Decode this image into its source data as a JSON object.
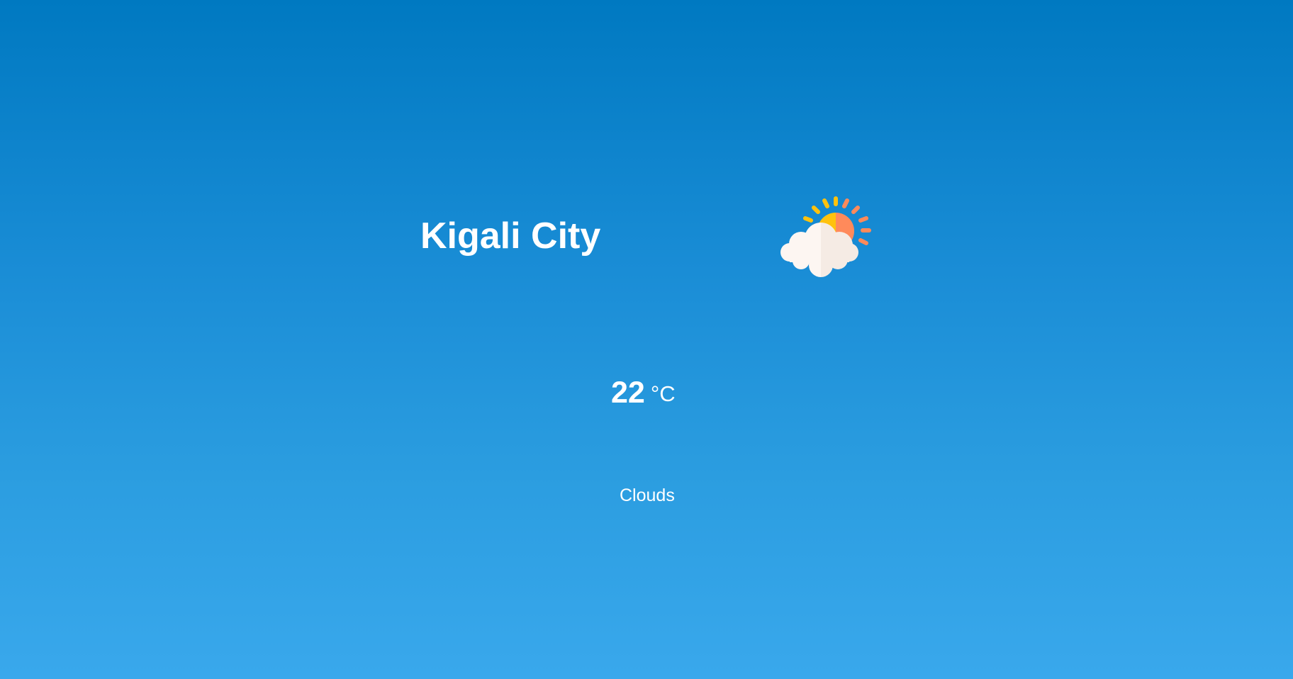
{
  "weather": {
    "city": "Kigali City",
    "temperature": "22",
    "unit": "°C",
    "condition": "Clouds",
    "icon": "partly-cloudy-icon"
  },
  "colors": {
    "background_top": "#0079c1",
    "background_bottom": "#39a8ec",
    "text": "#ffffff",
    "sun_left": "#ffc20e",
    "sun_right": "#ff8a5b",
    "cloud_left": "#fdf6f2",
    "cloud_right": "#f5ebe4"
  }
}
